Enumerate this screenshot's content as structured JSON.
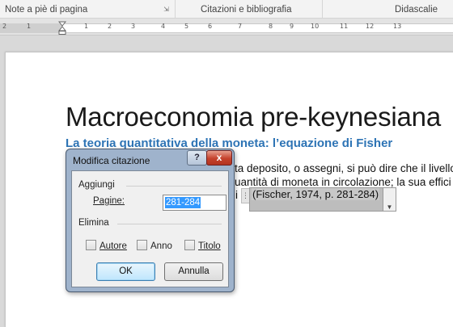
{
  "ribbon": {
    "groups": [
      "Note a piè di pagina",
      "Citazioni e bibliografia",
      "Didascalie"
    ]
  },
  "ruler": {
    "numbers": [
      "2",
      "1",
      "1",
      "2",
      "3",
      "4",
      "5",
      "6",
      "7",
      "8",
      "9",
      "10",
      "11",
      "12",
      "13"
    ]
  },
  "document": {
    "title": "Macroeconomia pre-keynesiana",
    "heading": "La teoria quantitativa della moneta: l’equazione di Fisher",
    "body_lines": [
      "ta deposito, o assegni, si può dire che il livello",
      "uantità di moneta in circolazione; la sua effici",
      "i"
    ],
    "citation": "(Fischer, 1974, p. 281-284)"
  },
  "dialog": {
    "title": "Modifica citazione",
    "help": "?",
    "close": "x",
    "add_section": "Aggiungi",
    "pages_label": "Pagine:",
    "pages_value": "281-284",
    "remove_section": "Elimina",
    "checkboxes": [
      {
        "label": "Autore",
        "checked": false
      },
      {
        "label": "Anno",
        "checked": false
      },
      {
        "label": "Titolo",
        "checked": false
      }
    ],
    "ok_label": "OK",
    "cancel_label": "Annulla"
  },
  "colors": {
    "heading": "#2e74b5",
    "selection": "#3399ff",
    "dialog_frame": "#9fb3cc",
    "close_button": "#c4412c"
  }
}
